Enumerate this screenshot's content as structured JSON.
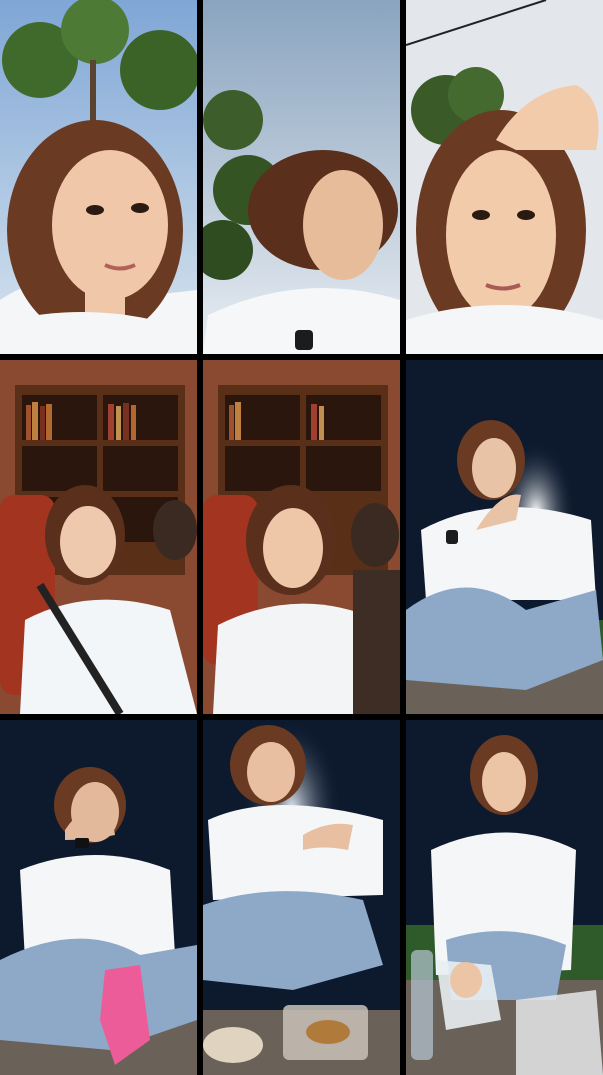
{
  "layout": {
    "rows": 3,
    "columns": 3
  },
  "tiles": [
    {
      "row": 1,
      "col": 1,
      "scene": "outdoor-daytime",
      "subject": "selfie-talking",
      "tone": "#f0c7a8"
    },
    {
      "row": 1,
      "col": 2,
      "scene": "outdoor-daytime-sky",
      "subject": "profile-looking-away",
      "tone": "#e6bc9b"
    },
    {
      "row": 1,
      "col": 3,
      "scene": "outdoor-daytime-sky",
      "subject": "hand-on-forehead",
      "tone": "#f2cbaa"
    },
    {
      "row": 2,
      "col": 1,
      "scene": "library-bookshelf-backdrop",
      "subject": "seated-armchair",
      "tone": "#efc9ad"
    },
    {
      "row": 2,
      "col": 2,
      "scene": "library-bookshelf-backdrop",
      "subject": "seated-eyes-closed",
      "tone": "#eec6a8"
    },
    {
      "row": 2,
      "col": 3,
      "scene": "night-outdoor-lamp",
      "subject": "sitting-cross-legged-waving",
      "tone": "#e9c3a6"
    },
    {
      "row": 3,
      "col": 1,
      "scene": "night-outdoor",
      "subject": "rubbing-eyes",
      "tone": "#e2b99a"
    },
    {
      "row": 3,
      "col": 2,
      "scene": "night-outdoor-picnic",
      "subject": "eating-snacks",
      "tone": "#e8bfa0"
    },
    {
      "row": 3,
      "col": 3,
      "scene": "night-outdoor-picnic",
      "subject": "opening-bag",
      "tone": "#ecc5a6"
    }
  ],
  "colors": {
    "sky_day": "#a9c4e0",
    "sky_night": "#0d1a2e",
    "brick": "#8a4a32",
    "shelf_wood": "#6b3a1e",
    "blouse": "#f4f6f8",
    "jeans": "#8ea8c8",
    "hair": "#6b3a22",
    "grass": "#2f5b2a",
    "ground": "#6a6258"
  }
}
